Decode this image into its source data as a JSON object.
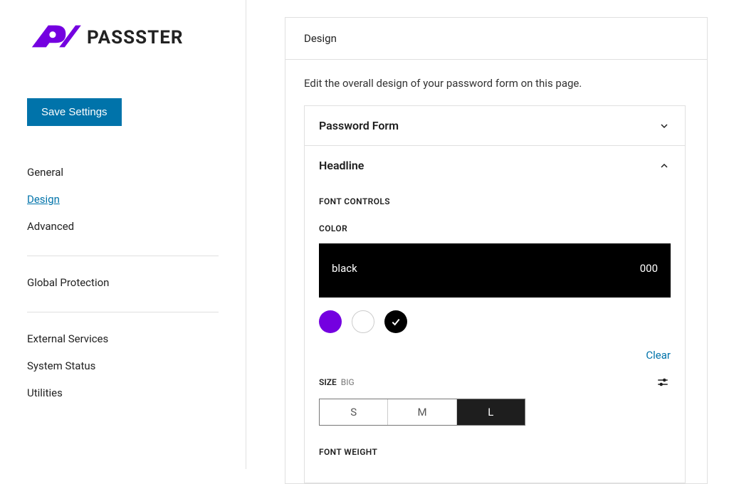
{
  "brand": {
    "name": "PASSSTER"
  },
  "sidebar": {
    "save_label": "Save Settings",
    "nav": {
      "general": "General",
      "design": "Design",
      "advanced": "Advanced",
      "global_protection": "Global Protection",
      "external_services": "External Services",
      "system_status": "System Status",
      "utilities": "Utilities"
    }
  },
  "main": {
    "header": "Design",
    "intro": "Edit the overall design of your password form on this page.",
    "sections": {
      "password_form": {
        "title": "Password Form"
      },
      "headline": {
        "title": "Headline",
        "font_controls": "FONT CONTROLS",
        "color_label": "COLOR",
        "color_name": "black",
        "color_value": "000",
        "clear": "Clear",
        "size_label": "SIZE",
        "size_value": "BIG",
        "sizes": {
          "s": "S",
          "m": "M",
          "l": "L"
        },
        "font_weight": "FONT WEIGHT"
      }
    },
    "swatches": {
      "purple": "#7400e0",
      "white": "#ffffff",
      "black": "#000000",
      "selected": "black"
    }
  }
}
